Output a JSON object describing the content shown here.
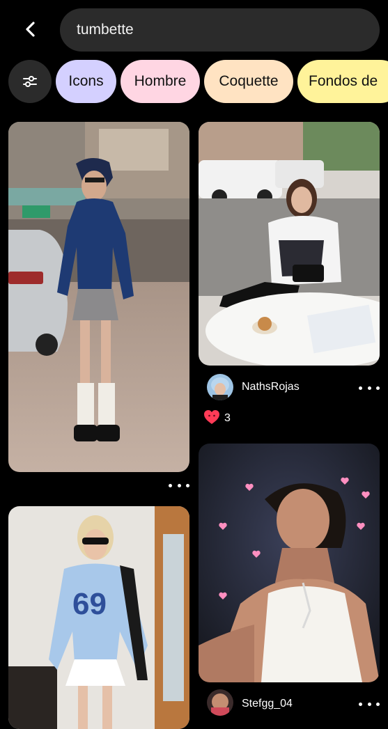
{
  "search": {
    "query": "tumbette"
  },
  "chips": [
    {
      "label": "Icons",
      "color": "#d4d0ff"
    },
    {
      "label": "Hombre",
      "color": "#ffd6e3"
    },
    {
      "label": "Coquette",
      "color": "#ffe3c2"
    },
    {
      "label": "Fondos de",
      "color": "#fff39a"
    }
  ],
  "pins": [
    {
      "name": "pin-street-outfit",
      "description": "girl in blue track jacket and pleated skirt on street"
    },
    {
      "name": "pin-cafe-outfit",
      "author": "NathsRojas",
      "likes": "3"
    },
    {
      "name": "pin-racing-jersey",
      "description": "girl in light blue racing jersey"
    },
    {
      "name": "pin-concert-singer",
      "author": "Stefgg_04"
    }
  ],
  "icons": {
    "back": "chevron-left-icon",
    "filter": "sliders-icon",
    "more": "more-horizontal-icon",
    "heart": "heart-reaction-icon"
  },
  "colors": {
    "background": "#000000",
    "search_bg": "#2b2b2b",
    "heart": "#ff3b57"
  }
}
